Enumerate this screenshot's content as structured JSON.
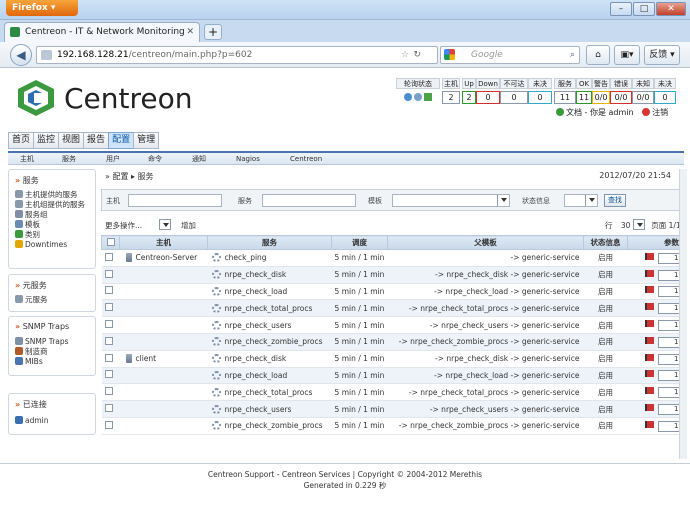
{
  "browser": {
    "app_button": "Firefox",
    "tab_title": "Centreon - IT & Network Monitoring",
    "new_tab": "+",
    "url_host": "192.168.128.21",
    "url_path": "/centreon/main.php?p=602",
    "search_placeholder": "Google",
    "feedback_button": "反馈"
  },
  "header": {
    "logo_text": "Centreon",
    "status_headers": [
      "轮询状态",
      "主机",
      "Up",
      "Down",
      "不可达",
      "未决",
      "服务",
      "OK",
      "警告",
      "错误",
      "未知",
      "未决"
    ],
    "status_values": [
      "2",
      "2",
      "0",
      "0",
      "0",
      "11",
      "11",
      "0/0",
      "0/0",
      "0/0",
      "0"
    ],
    "user_label": "文档 - 你是 admin",
    "logout": "注销"
  },
  "menu_top": [
    "首页",
    "监控",
    "视图",
    "报告",
    "配置",
    "管理"
  ],
  "menu_active": "配置",
  "menu_sub": [
    "主机",
    "服务",
    "用户",
    "命令",
    "通知",
    "Nagios",
    "Centreon"
  ],
  "sidebar": {
    "services_title": "服务",
    "services_items": [
      "主机提供的服务",
      "主机组提供的服务",
      "服务组",
      "模板",
      "类别",
      "Downtimes"
    ],
    "meta_title": "元服务",
    "meta_items": [
      "元服务"
    ],
    "snmp_title": "SNMP Traps",
    "snmp_items": [
      "SNMP Traps",
      "制造商",
      "MIBs"
    ],
    "connected_title": "已连接",
    "connected_items": [
      "admin"
    ]
  },
  "main": {
    "breadcrumb_1": "配置",
    "breadcrumb_2": "服务",
    "date": "2012/07/20 21:54",
    "filter": {
      "host_label": "主机",
      "service_label": "服务",
      "template_label": "模板",
      "status_label": "状态信息",
      "search_button": "查找"
    },
    "more_actions": "更多操作...",
    "add": "增加",
    "rows_label": "行",
    "rows_value": "30",
    "page_label": "页面 1/1",
    "columns": [
      "主机",
      "服务",
      "调度",
      "父模板",
      "状态信息",
      "参数"
    ],
    "rows": [
      {
        "host": "Centreon-Server",
        "service": "check_ping",
        "schedule": "5 min / 1 min",
        "parent": "-> generic-service",
        "status": "启用",
        "param": "1"
      },
      {
        "host": "",
        "service": "nrpe_check_disk",
        "schedule": "5 min / 1 min",
        "parent": "-> nrpe_check_disk -> generic-service",
        "status": "启用",
        "param": "1"
      },
      {
        "host": "",
        "service": "nrpe_check_load",
        "schedule": "5 min / 1 min",
        "parent": "-> nrpe_check_load -> generic-service",
        "status": "启用",
        "param": "1"
      },
      {
        "host": "",
        "service": "nrpe_check_total_procs",
        "schedule": "5 min / 1 min",
        "parent": "-> nrpe_check_total_procs -> generic-service",
        "status": "启用",
        "param": "1"
      },
      {
        "host": "",
        "service": "nrpe_check_users",
        "schedule": "5 min / 1 min",
        "parent": "-> nrpe_check_users -> generic-service",
        "status": "启用",
        "param": "1"
      },
      {
        "host": "",
        "service": "nrpe_check_zombie_procs",
        "schedule": "5 min / 1 min",
        "parent": "-> nrpe_check_zombie_procs -> generic-service",
        "status": "启用",
        "param": "1"
      },
      {
        "host": "client",
        "service": "nrpe_check_disk",
        "schedule": "5 min / 1 min",
        "parent": "-> nrpe_check_disk -> generic-service",
        "status": "启用",
        "param": "1"
      },
      {
        "host": "",
        "service": "nrpe_check_load",
        "schedule": "5 min / 1 min",
        "parent": "-> nrpe_check_load -> generic-service",
        "status": "启用",
        "param": "1"
      },
      {
        "host": "",
        "service": "nrpe_check_total_procs",
        "schedule": "5 min / 1 min",
        "parent": "-> nrpe_check_total_procs -> generic-service",
        "status": "启用",
        "param": "1"
      },
      {
        "host": "",
        "service": "nrpe_check_users",
        "schedule": "5 min / 1 min",
        "parent": "-> nrpe_check_users -> generic-service",
        "status": "启用",
        "param": "1"
      },
      {
        "host": "",
        "service": "nrpe_check_zombie_procs",
        "schedule": "5 min / 1 min",
        "parent": "-> nrpe_check_zombie_procs -> generic-service",
        "status": "启用",
        "param": "1"
      }
    ]
  },
  "footer": {
    "line1": "Centreon Support - Centreon Services | Copyright © 2004-2012 Merethis",
    "line2": "Generated in 0.229 秒"
  },
  "colors": {
    "accent": "#4a73b0",
    "ok_green": "#2a9a2a",
    "down_red": "#d32f2f"
  }
}
